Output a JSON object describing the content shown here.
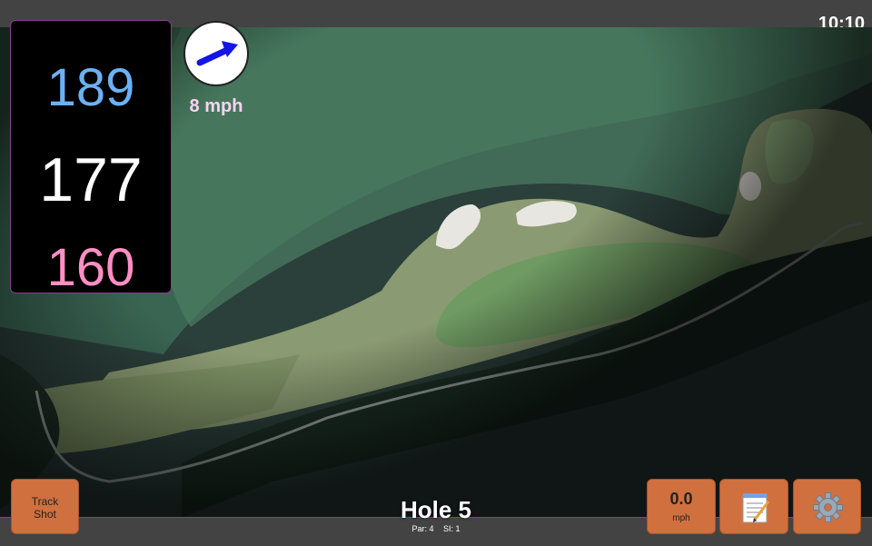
{
  "header": {
    "clock": "10:10"
  },
  "distances": {
    "back": "189",
    "middle": "177",
    "front": "160"
  },
  "wind": {
    "speed_text": "8 mph"
  },
  "hole": {
    "title": "Hole 5",
    "par": "Par: 4",
    "si": "SI: 1"
  },
  "buttons": {
    "track_shot": [
      "Track",
      "Shot"
    ],
    "speed_value": "0.0",
    "speed_unit": "mph",
    "notes_icon": "notepad-icon",
    "settings_icon": "gear-icon"
  },
  "colors": {
    "back_distance": "#6bb1f5",
    "middle_distance": "#ffffff",
    "front_distance": "#ff8fc4",
    "button": "#d0703f",
    "accent_border": "#8a3e8e"
  }
}
